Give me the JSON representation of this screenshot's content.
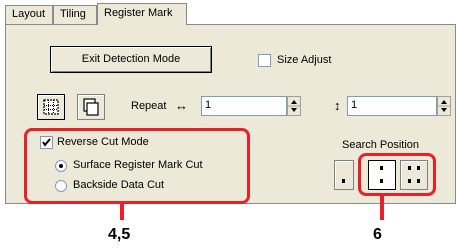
{
  "tabs": [
    {
      "label": "Layout"
    },
    {
      "label": "Tiling"
    },
    {
      "label": "Register Mark"
    }
  ],
  "exit_button": {
    "label": "Exit Detection Mode"
  },
  "size_adjust": {
    "label": "Size Adjust",
    "checked": false
  },
  "repeat": {
    "label": "Repeat",
    "horizontal_symbol": "↔",
    "horizontal_value": "1",
    "vertical_symbol": "↕",
    "vertical_value": "1"
  },
  "reverse_cut": {
    "label": "Reverse Cut Mode",
    "checked": true
  },
  "radio_options": [
    {
      "label": "Surface Register Mark Cut",
      "selected": true
    },
    {
      "label": "Backside Data Cut",
      "selected": false
    }
  ],
  "search_position": {
    "label": "Search Position"
  },
  "callouts": {
    "left": "4,5",
    "right": "6"
  },
  "colors": {
    "highlight": "#e8202a",
    "panel": "#ece9d8"
  }
}
